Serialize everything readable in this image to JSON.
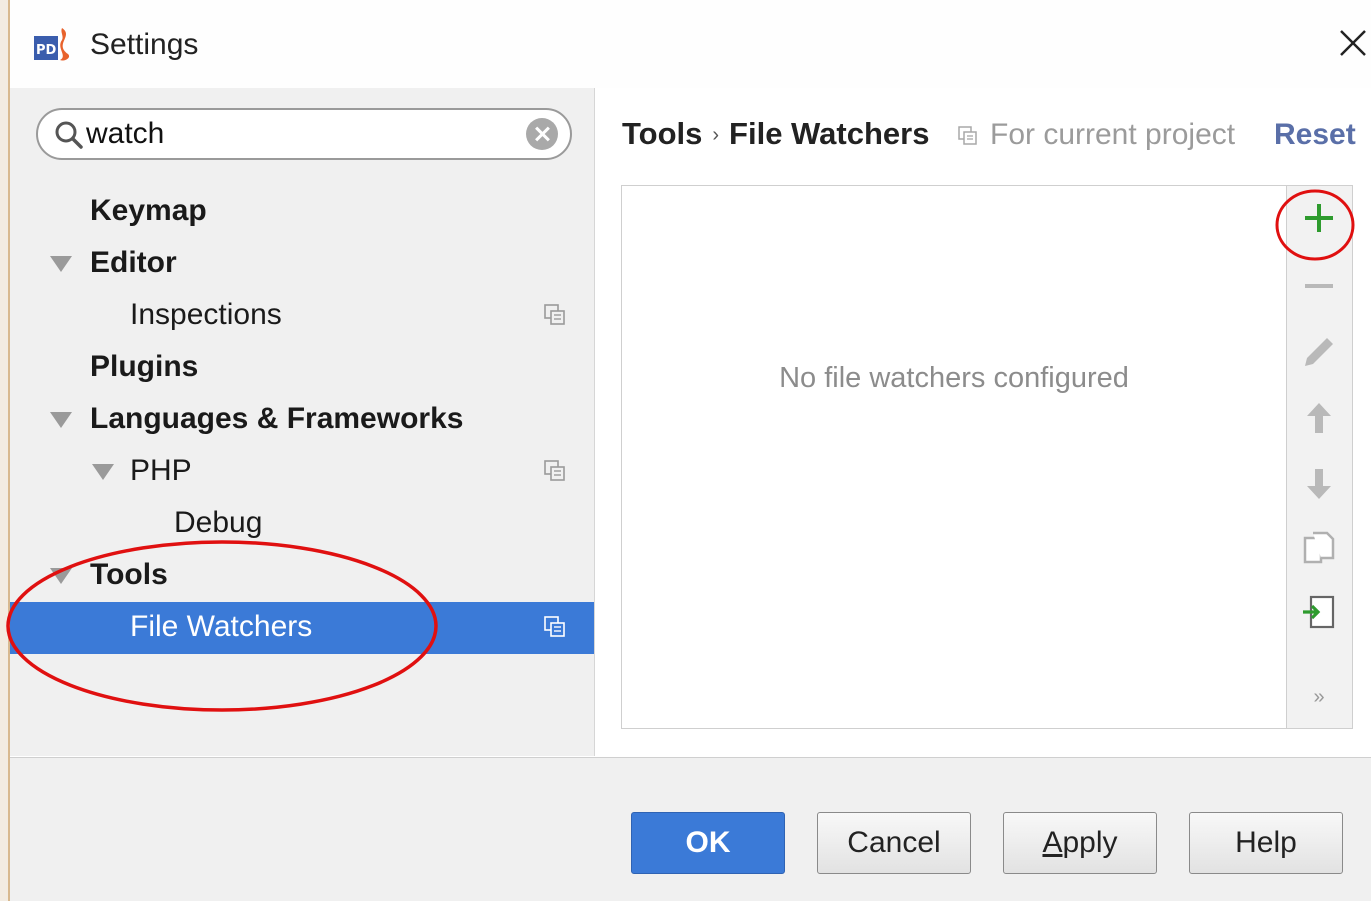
{
  "window": {
    "title": "Settings"
  },
  "search": {
    "value": "watch"
  },
  "tree": [
    {
      "label": "Keymap",
      "bold": true,
      "expanded": null
    },
    {
      "label": "Editor",
      "bold": true,
      "expanded": true
    },
    {
      "label": "Inspections",
      "bold": false,
      "expanded": null,
      "project_icon": true
    },
    {
      "label": "Plugins",
      "bold": true,
      "expanded": null
    },
    {
      "label": "Languages & Frameworks",
      "bold": true,
      "expanded": true
    },
    {
      "label": "PHP",
      "bold": false,
      "expanded": true,
      "project_icon": true
    },
    {
      "label": "Debug",
      "bold": false,
      "expanded": null
    },
    {
      "label": "Tools",
      "bold": true,
      "expanded": true
    },
    {
      "label": "File Watchers",
      "bold": false,
      "expanded": null,
      "project_icon": true,
      "selected": true
    }
  ],
  "header": {
    "crumb_root": "Tools",
    "crumb_separator": "›",
    "crumb_current": "File Watchers",
    "scope": "For current project",
    "reset": "Reset"
  },
  "list": {
    "empty_message": "No file watchers configured"
  },
  "toolbar": {
    "add_icon": "plus-icon",
    "remove_icon": "minus-icon",
    "edit_icon": "pencil-icon",
    "up_icon": "arrow-up-icon",
    "down_icon": "arrow-down-icon",
    "copy_icon": "copy-icon",
    "import_icon": "import-icon",
    "more": "»"
  },
  "buttons": {
    "ok": "OK",
    "cancel": "Cancel",
    "apply": "Apply",
    "help": "Help"
  },
  "colors": {
    "selection": "#3b7ad7",
    "annotation": "#e01010",
    "add_green": "#2e9b2e",
    "link": "#5a6fa8"
  }
}
